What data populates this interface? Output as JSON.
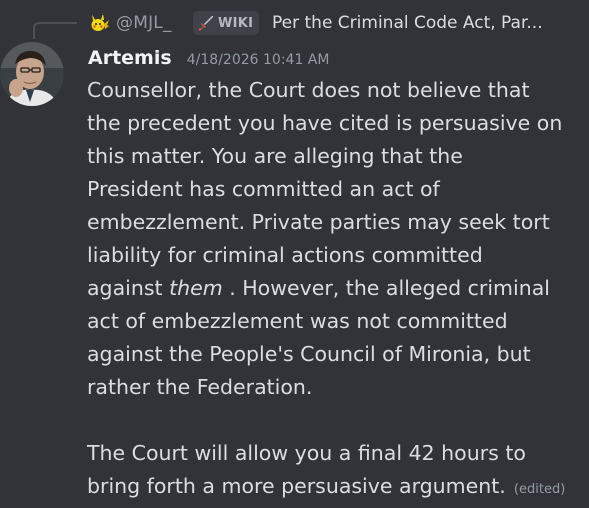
{
  "reply": {
    "username": "@MJL_",
    "badge": "WIKI",
    "badge_icon": "sword-icon",
    "avatar_icon": "pikachu-icon",
    "preview": "Per the Criminal Code Act, Par..."
  },
  "message": {
    "author": "Artemis",
    "timestamp": "4/18/2026 10:41 AM",
    "paragraph1": {
      "line1": "Counsellor, the Court does not believe that",
      "line2": "the precedent you have cited is persuasive on",
      "line3": "this matter. You are alleging that the",
      "line4": "President has committed an act of",
      "line5": "embezzlement. Private parties may seek tort",
      "line6": "liability for criminal actions committed",
      "line7_pre": "against ",
      "line7_em": "them",
      "line7_post": " . However, the alleged criminal",
      "line8": "act of embezzlement was not committed",
      "line9": "against the People's Council of Mironia, but",
      "line10": "rather the Federation."
    },
    "paragraph2": {
      "line1": "The Court will allow you a final 42 hours to",
      "line2": "bring forth a more persuasive argument."
    },
    "edited_label": "(edited)"
  },
  "colors": {
    "background": "#313338",
    "text": "#dbdee1",
    "muted": "#949ba4",
    "author": "#f2f3f5"
  }
}
